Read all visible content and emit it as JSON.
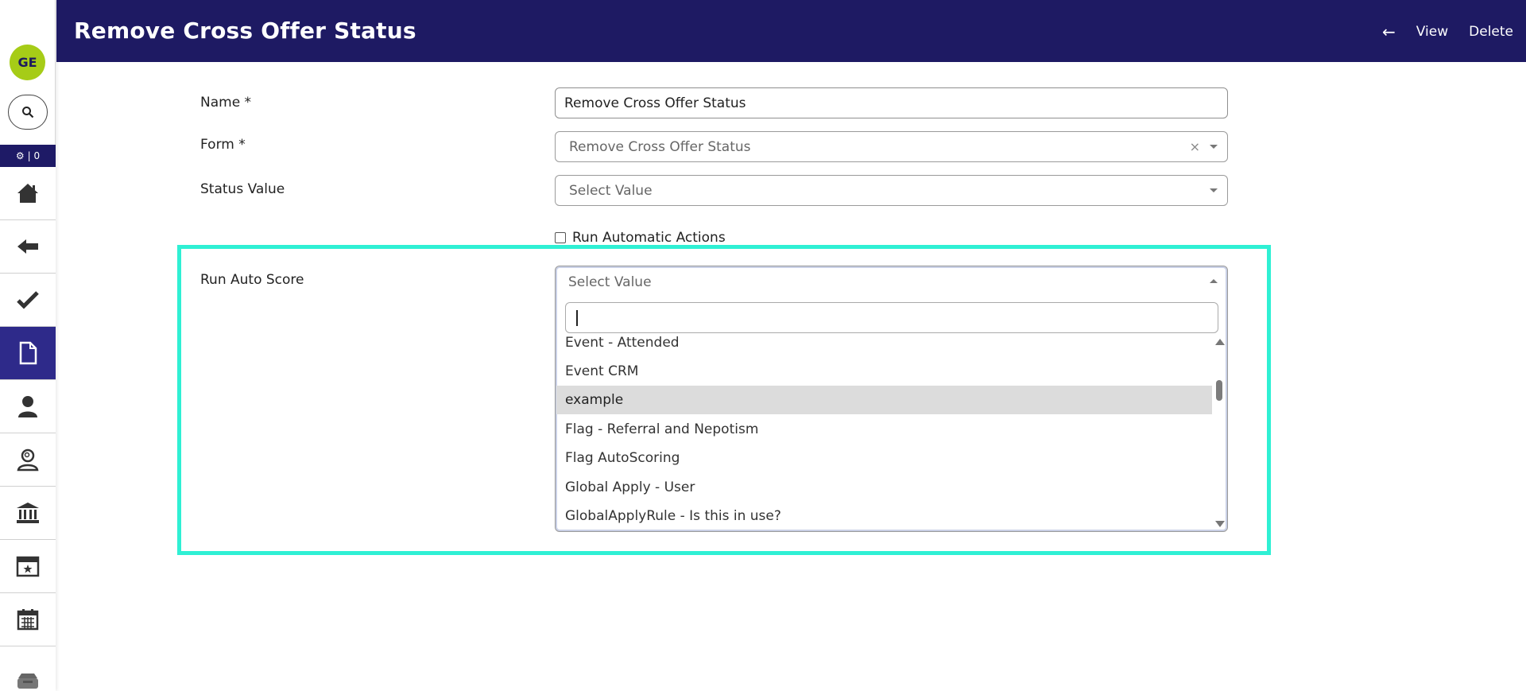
{
  "sidebar": {
    "avatar_initials": "GE",
    "settings_badge": "| 0",
    "items": [
      {
        "icon": "home-icon"
      },
      {
        "icon": "back-arrow-icon"
      },
      {
        "icon": "checkmark-icon"
      },
      {
        "icon": "document-icon",
        "active": true
      },
      {
        "icon": "person-icon"
      },
      {
        "icon": "person-search-icon"
      },
      {
        "icon": "bank-icon"
      },
      {
        "icon": "calendar-star-icon"
      },
      {
        "icon": "calendar-icon"
      },
      {
        "icon": "inbox-icon"
      }
    ]
  },
  "header": {
    "title": "Remove Cross Offer Status",
    "back_icon": "←",
    "view_label": "View",
    "delete_label": "Delete",
    "background": "#1e1a63"
  },
  "form": {
    "name": {
      "label": "Name *",
      "value": "Remove Cross Offer Status"
    },
    "form_field": {
      "label": "Form *",
      "value": "Remove Cross Offer Status",
      "clear": "×"
    },
    "status_value": {
      "label": "Status Value",
      "placeholder": "Select Value"
    },
    "run_automatic_actions": {
      "label": "Run Automatic Actions",
      "checked": false
    },
    "run_auto_score": {
      "label": "Run Auto Score",
      "placeholder": "Select Value",
      "search_value": "",
      "options": [
        "Event - Attended",
        "Event CRM",
        "example",
        "Flag - Referral and Nepotism",
        "Flag AutoScoring",
        "Global Apply - User",
        "GlobalApplyRule - Is this in use?"
      ],
      "highlighted_option": "example"
    }
  },
  "colors": {
    "accent": "#2e2a8a",
    "avatar": "#a6cc17",
    "highlight_frame": "#2ff0d4"
  }
}
